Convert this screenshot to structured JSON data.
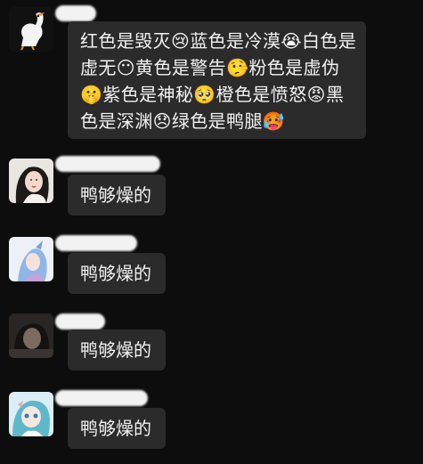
{
  "messages": [
    {
      "text": "红色是毁灭😢蓝色是冷漠😭白色是虚无😶黄色是警告🤥粉色是虚伪🤫紫色是神秘🥺橙色是愤怒😡黑色是深渊😞绿色是鸭腿🥵",
      "avatar_icon": "white-goose-avatar-icon"
    },
    {
      "text": "鸭够燥的",
      "avatar_icon": "girl-photo-avatar-icon"
    },
    {
      "text": "鸭够燥的",
      "avatar_icon": "anime-character-avatar-icon"
    },
    {
      "text": "鸭够燥的",
      "avatar_icon": "dark-photo-avatar-icon"
    },
    {
      "text": "鸭够燥的",
      "avatar_icon": "blue-hair-anime-avatar-icon"
    }
  ],
  "colors": {
    "background": "#0d0d0d",
    "bubble": "#2b2b2b",
    "text": "#f2f2f2",
    "redacted_name": "#f2f2f2"
  }
}
